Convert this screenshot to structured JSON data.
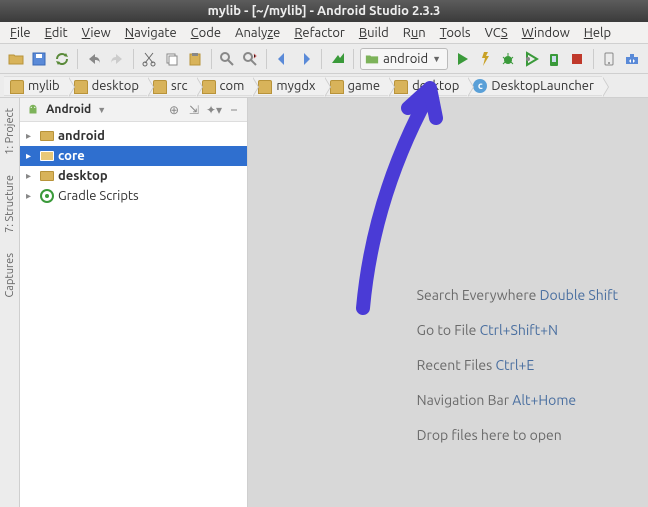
{
  "title": "mylib - [~/mylib] - Android Studio 2.3.3",
  "menu": [
    "File",
    "Edit",
    "View",
    "Navigate",
    "Code",
    "Analyze",
    "Refactor",
    "Build",
    "Run",
    "Tools",
    "VCS",
    "Window",
    "Help"
  ],
  "run_config": "android",
  "breadcrumbs": [
    {
      "label": "mylib",
      "icon": "folder"
    },
    {
      "label": "desktop",
      "icon": "folder"
    },
    {
      "label": "src",
      "icon": "folder"
    },
    {
      "label": "com",
      "icon": "folder"
    },
    {
      "label": "mygdx",
      "icon": "folder"
    },
    {
      "label": "game",
      "icon": "folder"
    },
    {
      "label": "desktop",
      "icon": "folder"
    },
    {
      "label": "DesktopLauncher",
      "icon": "class"
    }
  ],
  "side_tabs": [
    "1: Project",
    "7: Structure",
    "Captures"
  ],
  "project_header": {
    "label": "Android"
  },
  "tree": [
    {
      "label": "android",
      "selected": false
    },
    {
      "label": "core",
      "selected": true
    },
    {
      "label": "desktop",
      "selected": false
    },
    {
      "label": "Gradle Scripts",
      "selected": false,
      "gradle": true
    }
  ],
  "tips": [
    {
      "text": "Search Everywhere ",
      "shortcut": "Double Shift"
    },
    {
      "text": "Go to File ",
      "shortcut": "Ctrl+Shift+N"
    },
    {
      "text": "Recent Files ",
      "shortcut": "Ctrl+E"
    },
    {
      "text": "Navigation Bar ",
      "shortcut": "Alt+Home"
    },
    {
      "text": "Drop files here to open",
      "shortcut": ""
    }
  ]
}
